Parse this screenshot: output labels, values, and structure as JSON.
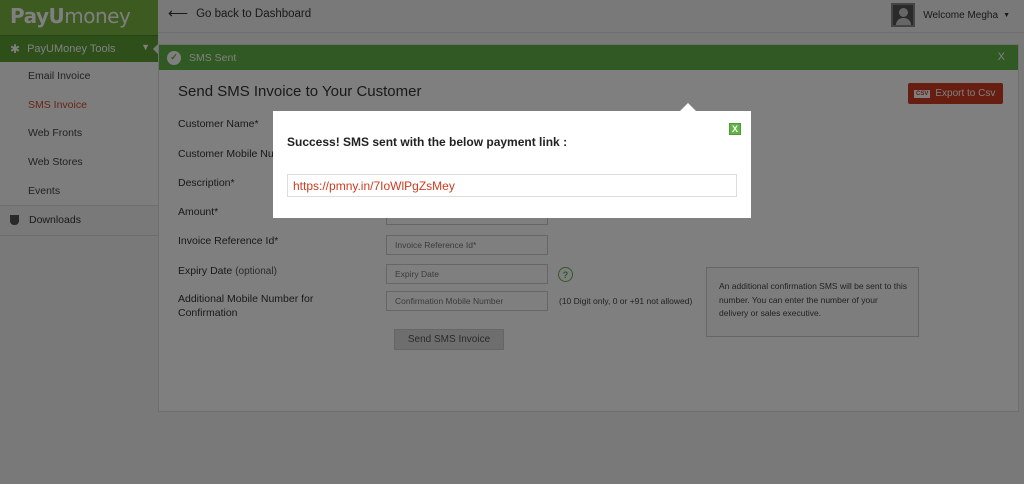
{
  "sidebar": {
    "logo": {
      "part1": "PayU",
      "part2": "money"
    },
    "tools_label": "PayUMoney Tools",
    "items": [
      {
        "label": "Email Invoice"
      },
      {
        "label": "SMS Invoice"
      },
      {
        "label": "Web Fronts"
      },
      {
        "label": "Web Stores"
      },
      {
        "label": "Events"
      }
    ],
    "downloads_label": "Downloads"
  },
  "topbar": {
    "back_label": "Go back to Dashboard",
    "welcome_label": "Welcome Megha"
  },
  "banner": {
    "message": "SMS Sent",
    "close_label": "X"
  },
  "page": {
    "title": "Send SMS Invoice to Your Customer",
    "export_label": "Export to Csv",
    "export_icon_text": "CSV"
  },
  "form": {
    "customer_name_label": "Customer Name*",
    "customer_mobile_label": "Customer Mobile Nu",
    "description_label": "Description*",
    "amount_label": "Amount*",
    "invoice_ref_label": "Invoice Reference Id*",
    "invoice_ref_placeholder": "Invoice Reference Id*",
    "expiry_label": "Expiry Date",
    "expiry_optional": "(optional)",
    "expiry_placeholder": "Expiry Date",
    "additional_mobile_label_line1": "Additional Mobile Number for",
    "additional_mobile_label_line2": "Confirmation",
    "confirmation_placeholder": "Confirmation Mobile Number",
    "confirmation_hint": "(10 Digit only, 0 or +91 not allowed)",
    "tooltip_text": "An additional confirmation SMS will be sent to this number. You can enter the number of your delivery or sales executive.",
    "send_label": "Send SMS Invoice"
  },
  "modal": {
    "message": "Success! SMS sent with the below payment link :",
    "link": "https://pmny.in/7IoWlPgZsMey",
    "close_label": "X"
  },
  "colors": {
    "brand_green": "#7ab541",
    "banner_green": "#63b346",
    "accent_red": "#cf3a1e"
  }
}
